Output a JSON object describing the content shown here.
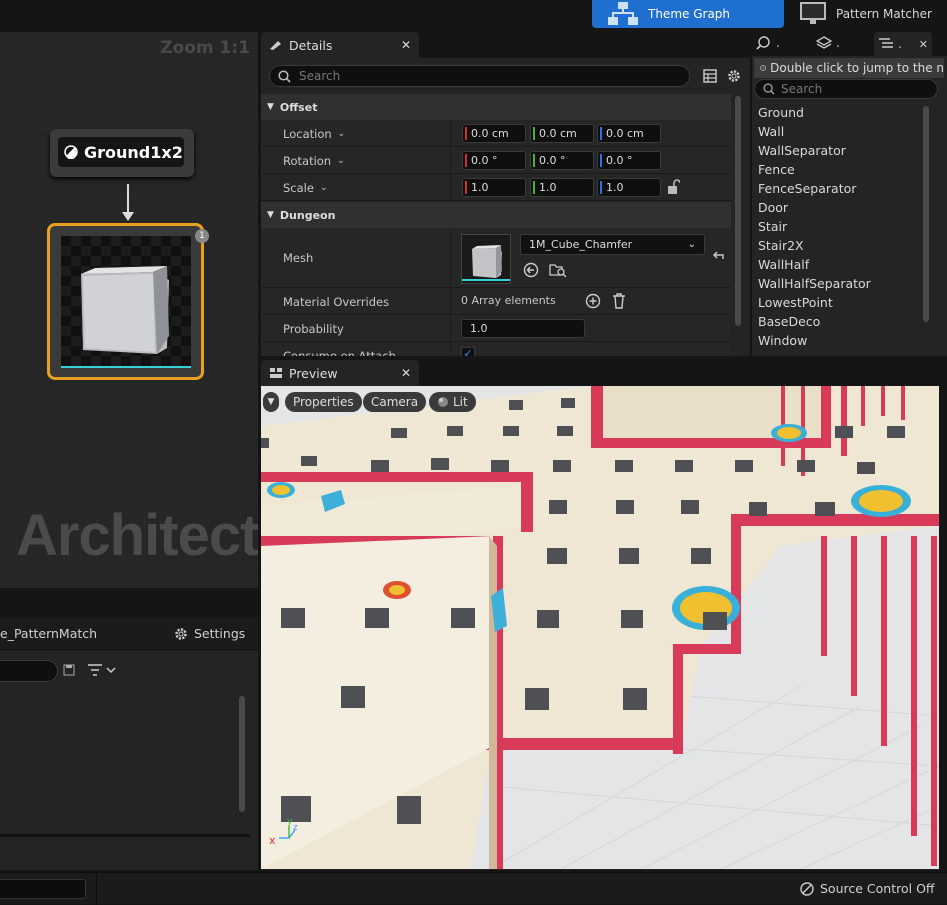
{
  "toolbar": {
    "theme_graph_label": "Theme Graph",
    "pattern_matcher_label": "Pattern Matcher"
  },
  "graph": {
    "zoom_label": "Zoom 1:1",
    "watermark": "Architect",
    "marker_node_label": "Ground1x2",
    "visual_node_badge": "1"
  },
  "pattern_panel": {
    "tab_label": "e_PatternMatch",
    "settings_label": "Settings"
  },
  "details": {
    "tab_label": "Details",
    "search_placeholder": "Search",
    "categories": {
      "offset": "Offset",
      "dungeon": "Dungeon"
    },
    "rows": {
      "location": {
        "label": "Location",
        "x": "0.0 cm",
        "y": "0.0 cm",
        "z": "0.0 cm"
      },
      "rotation": {
        "label": "Rotation",
        "x": "0.0 °",
        "y": "0.0 °",
        "z": "0.0 °"
      },
      "scale": {
        "label": "Scale",
        "x": "1.0",
        "y": "1.0",
        "z": "1.0"
      },
      "mesh": {
        "label": "Mesh",
        "value": "1M_Cube_Chamfer"
      },
      "material_overrides": {
        "label": "Material Overrides",
        "value": "0 Array elements"
      },
      "probability": {
        "label": "Probability",
        "value": "1.0"
      },
      "consume_on_attach": {
        "label": "Consume on Attach"
      }
    }
  },
  "outliner": {
    "tab_labels": [
      ".",
      ".",
      "."
    ],
    "tip": "Double click to jump to the n",
    "search_placeholder": "Search",
    "items": [
      "Ground",
      "Wall",
      "WallSeparator",
      "Fence",
      "FenceSeparator",
      "Door",
      "Stair",
      "Stair2X",
      "WallHalf",
      "WallHalfSeparator",
      "LowestPoint",
      "BaseDeco",
      "Window"
    ]
  },
  "preview": {
    "tab_label": "Preview",
    "buttons": {
      "properties": "Properties",
      "camera": "Camera",
      "lit": "Lit"
    }
  },
  "statusbar": {
    "source_control": "Source Control Off"
  },
  "colors": {
    "accent_blue": "#1f6fd0",
    "selection_orange": "#e8a020",
    "wall_red": "#d83a5a",
    "floor_cream": "#efe6d3"
  }
}
